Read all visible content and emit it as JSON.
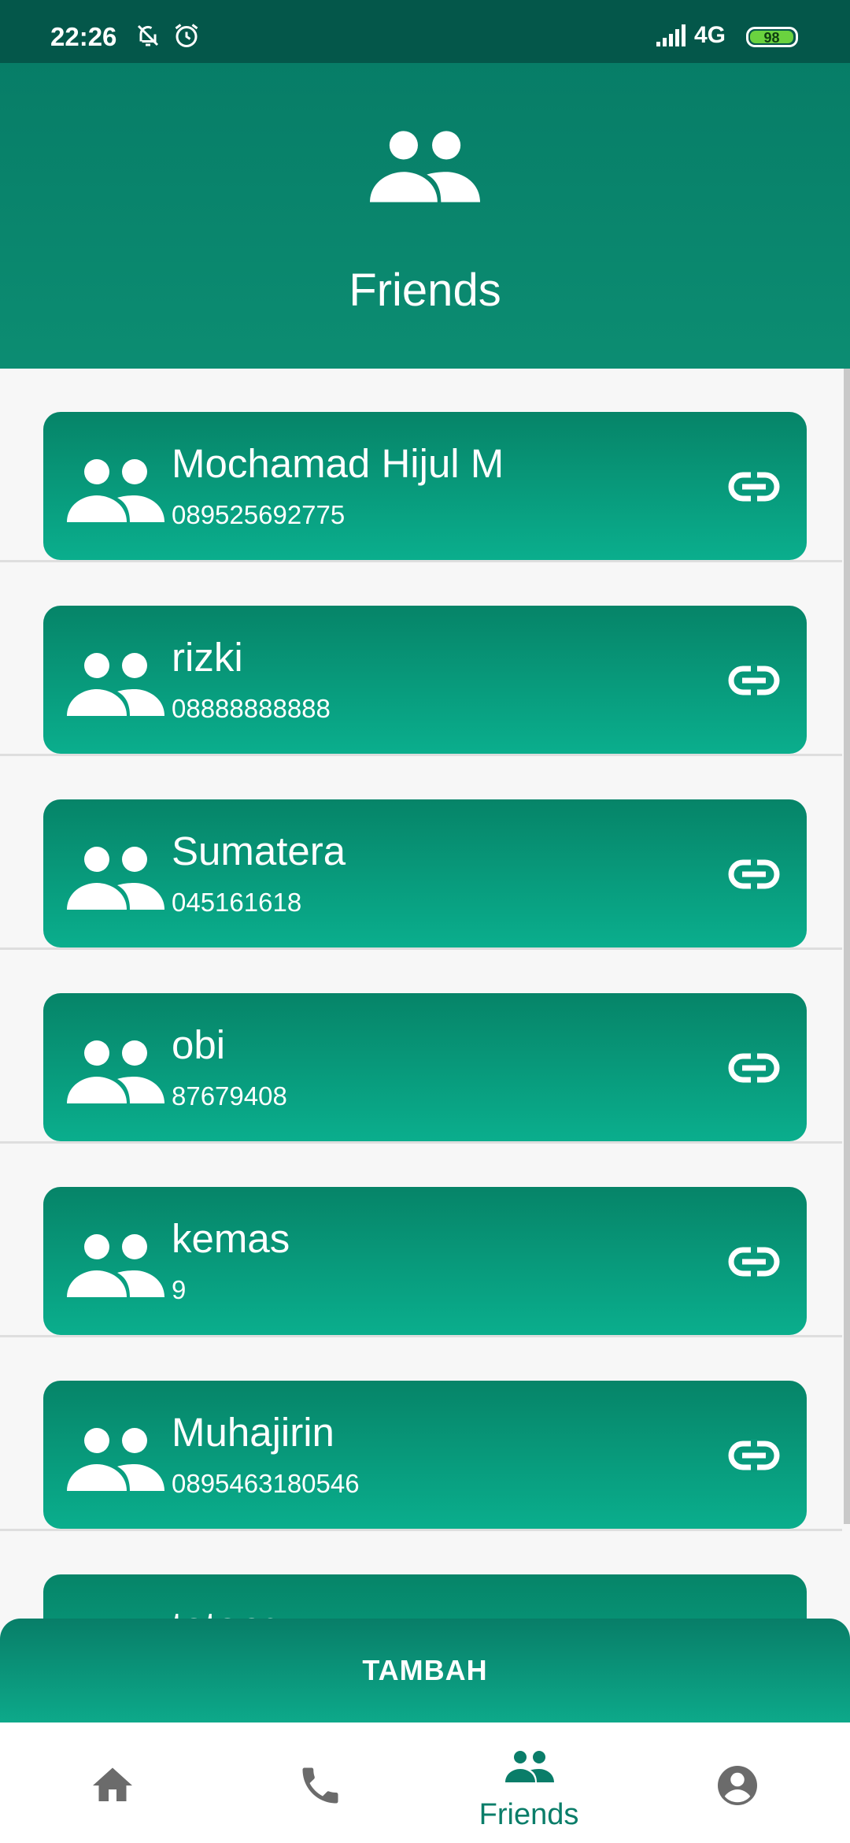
{
  "status_bar": {
    "time": "22:26",
    "network": "4G",
    "battery": "98"
  },
  "header": {
    "title": "Friends",
    "icon": "friends-icon"
  },
  "friends": [
    {
      "name": "Mochamad Hijul M",
      "phone": "089525692775"
    },
    {
      "name": "rizki",
      "phone": "08888888888"
    },
    {
      "name": "Sumatera",
      "phone": "045161618"
    },
    {
      "name": "obi",
      "phone": "87679408"
    },
    {
      "name": "kemas",
      "phone": "9"
    },
    {
      "name": "Muhajirin",
      "phone": "0895463180546"
    },
    {
      "name": "totong",
      "phone": ""
    }
  ],
  "actions": {
    "add_label": "TAMBAH"
  },
  "bottom_nav": {
    "items": [
      {
        "icon": "home-icon",
        "label": ""
      },
      {
        "icon": "phone-icon",
        "label": ""
      },
      {
        "icon": "friends-icon",
        "label": "Friends"
      },
      {
        "icon": "account-icon",
        "label": ""
      }
    ],
    "active_index": 2
  },
  "colors": {
    "primary": "#0c8d72",
    "primary_dark": "#04574a",
    "accent_nav": "#0a7d69",
    "inactive_icon": "#6b6b6b"
  }
}
